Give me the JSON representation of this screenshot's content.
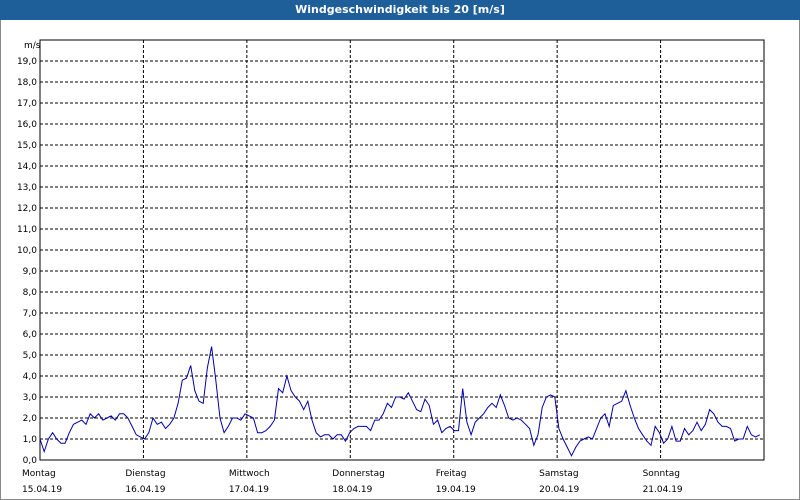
{
  "window": {
    "title": "Windgeschwindigkeit bis 20 [m/s]"
  },
  "chart_data": {
    "type": "line",
    "title": "Windgeschwindigkeit bis 20 [m/s]",
    "ylabel": "m/s",
    "ylim": [
      0,
      20
    ],
    "yticks": [
      "0,0",
      "1,0",
      "2,0",
      "3,0",
      "4,0",
      "5,0",
      "6,0",
      "7,0",
      "8,0",
      "9,0",
      "10,0",
      "11,0",
      "12,0",
      "13,0",
      "14,0",
      "15,0",
      "16,0",
      "17,0",
      "18,0",
      "19,0"
    ],
    "x_days": [
      {
        "day": "Montag",
        "date": "15.04.19"
      },
      {
        "day": "Dienstag",
        "date": "16.04.19"
      },
      {
        "day": "Mittwoch",
        "date": "17.04.19"
      },
      {
        "day": "Donnerstag",
        "date": "18.04.19"
      },
      {
        "day": "Freitag",
        "date": "19.04.19"
      },
      {
        "day": "Samstag",
        "date": "20.04.19"
      },
      {
        "day": "Sonntag",
        "date": "21.04.19"
      }
    ],
    "xlim_days": [
      0,
      7
    ],
    "grid": true,
    "colors": {
      "line": "#0000aa",
      "grid": "#000000",
      "title_bar": "#1f5f99"
    },
    "series": [
      {
        "values": [
          1.0,
          0.4,
          1.0,
          1.3,
          1.0,
          0.8,
          0.8,
          1.3,
          1.7,
          1.8,
          1.9,
          1.7,
          2.2,
          2.0,
          2.2,
          1.9,
          2.0,
          2.1,
          1.9,
          2.2,
          2.2,
          2.0,
          1.6,
          1.2,
          1.1,
          1.0,
          1.3,
          2.0,
          1.7,
          1.8,
          1.5,
          1.7,
          2.0,
          2.7,
          3.8,
          3.9,
          4.5,
          3.3,
          2.8,
          2.7,
          4.4,
          5.4,
          3.8,
          2.0,
          1.3,
          1.6,
          2.0,
          2.0,
          1.9,
          2.2,
          2.1,
          2.0,
          1.3,
          1.3,
          1.4,
          1.6,
          1.9,
          3.4,
          3.2,
          4.0,
          3.3,
          3.0,
          2.8,
          2.4,
          2.8,
          1.9,
          1.3,
          1.1,
          1.2,
          1.2,
          1.0,
          1.2,
          1.2,
          0.9,
          1.3,
          1.5,
          1.6,
          1.6,
          1.6,
          1.4,
          1.9,
          1.9,
          2.2,
          2.7,
          2.5,
          3.0,
          3.0,
          2.9,
          3.2,
          2.8,
          2.4,
          2.3,
          2.9,
          2.6,
          1.7,
          1.9,
          1.3,
          1.5,
          1.6,
          1.4,
          1.4,
          3.4,
          1.8,
          1.2,
          1.8,
          2.0,
          2.2,
          2.5,
          2.7,
          2.5,
          3.1,
          2.6,
          2.0,
          1.9,
          2.0,
          1.9,
          1.7,
          1.5,
          0.7,
          1.2,
          2.5,
          3.0,
          3.1,
          3.0,
          1.5,
          1.0,
          0.6,
          0.2,
          0.6,
          0.9,
          1.0,
          1.1,
          1.0,
          1.5,
          2.0,
          2.2,
          1.6,
          2.6,
          2.7,
          2.8,
          3.3,
          2.6,
          2.0,
          1.5,
          1.2,
          0.9,
          0.7,
          1.6,
          1.3,
          0.8,
          1.0,
          1.6,
          0.9,
          0.9,
          1.5,
          1.2,
          1.4,
          1.8,
          1.4,
          1.7,
          2.4,
          2.2,
          1.8,
          1.6,
          1.6,
          1.5,
          0.9,
          1.0,
          1.0,
          1.6,
          1.2,
          1.1,
          1.2
        ]
      }
    ]
  }
}
